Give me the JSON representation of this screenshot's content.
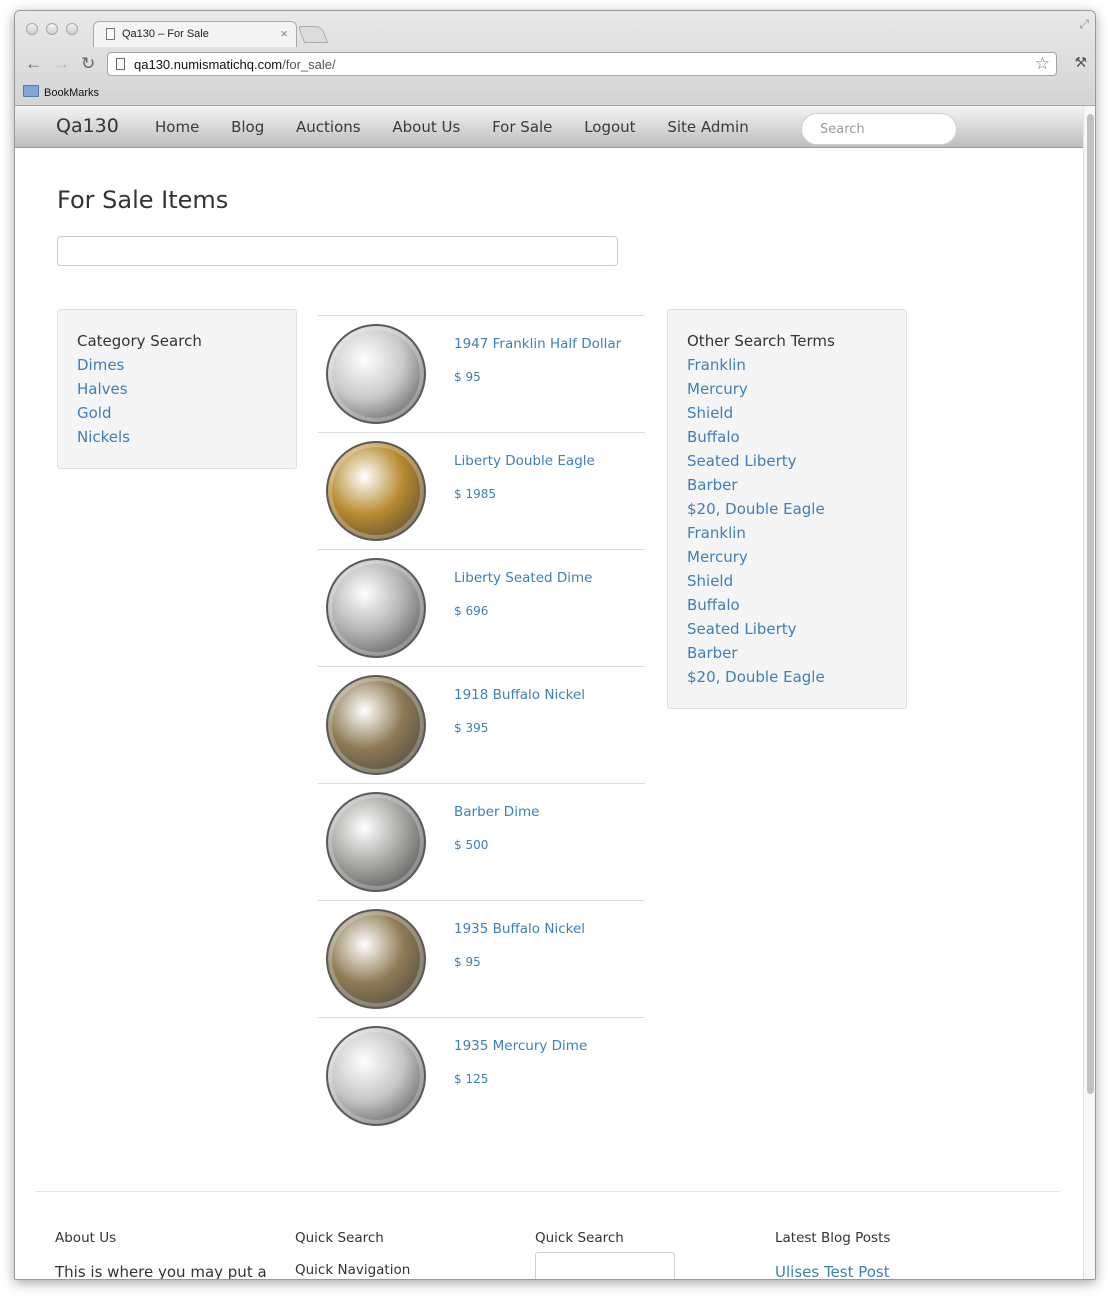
{
  "browser": {
    "tab_title": "Qa130 – For Sale",
    "url_host": "qa130.numismatichq.com",
    "url_path": "/for_sale/",
    "bookmarks_label": "BookMarks"
  },
  "navbar": {
    "brand": "Qa130",
    "links": [
      "Home",
      "Blog",
      "Auctions",
      "About Us",
      "For Sale",
      "Logout",
      "Site Admin"
    ],
    "search_placeholder": "Search"
  },
  "page": {
    "title": "For Sale Items",
    "search_value": ""
  },
  "category_search": {
    "heading": "Category Search",
    "links": [
      "Dimes",
      "Halves",
      "Gold",
      "Nickels"
    ]
  },
  "items": [
    {
      "name": "1947 Franklin Half Dollar",
      "price": "$ 95",
      "coin_color": "#c9c9c9"
    },
    {
      "name": "Liberty Double Eagle",
      "price": "$ 1985",
      "coin_color": "#b78a2e"
    },
    {
      "name": "Liberty Seated Dime",
      "price": "$ 696",
      "coin_color": "#b3b3b3"
    },
    {
      "name": "1918 Buffalo Nickel",
      "price": "$ 395",
      "coin_color": "#8d7a54"
    },
    {
      "name": "Barber Dime",
      "price": "$ 500",
      "coin_color": "#a4a6a1"
    },
    {
      "name": "1935 Buffalo Nickel",
      "price": "$ 95",
      "coin_color": "#8f7c55"
    },
    {
      "name": "1935 Mercury Dime",
      "price": "$ 125",
      "coin_color": "#c6c6c6"
    }
  ],
  "other_search": {
    "heading": "Other Search Terms",
    "links": [
      "Franklin",
      "Mercury",
      "Shield",
      "Buffalo",
      "Seated Liberty",
      "Barber",
      "$20, Double Eagle",
      "Franklin",
      "Mercury",
      "Shield",
      "Buffalo",
      "Seated Liberty",
      "Barber",
      "$20, Double Eagle"
    ]
  },
  "footer": {
    "about_heading": "About Us",
    "about_text": "This is where you may put a",
    "quick_search_heading_1": "Quick Search",
    "quick_navigation": "Quick Navigation",
    "quick_search_heading_2": "Quick Search",
    "blog_heading": "Latest Blog Posts",
    "blog_link": "Ulises Test Post"
  }
}
